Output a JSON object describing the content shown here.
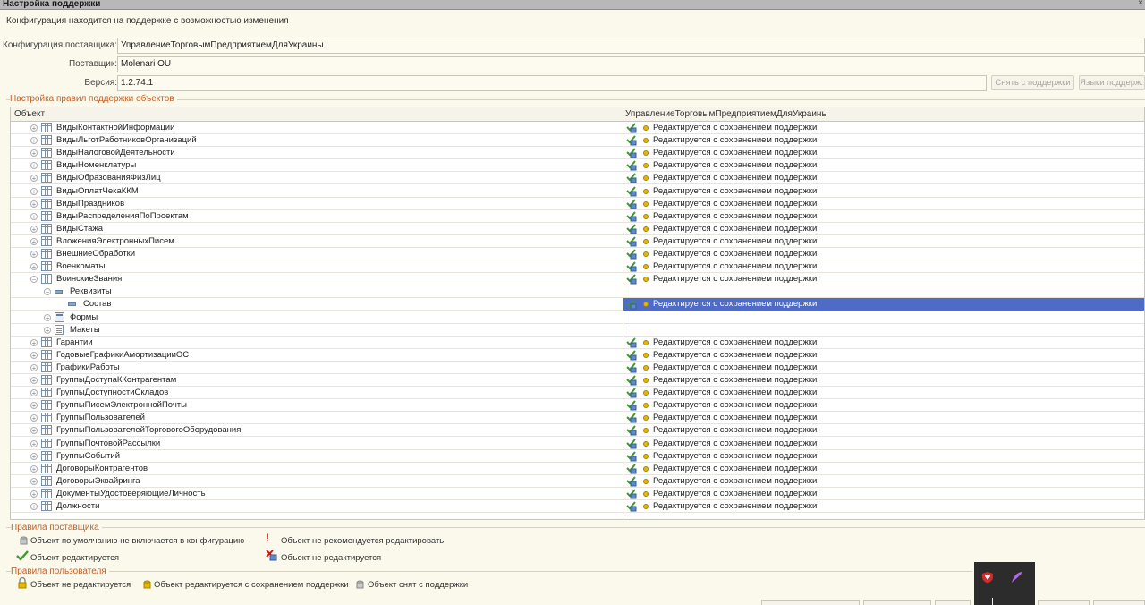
{
  "window": {
    "title": "Настройка поддержки",
    "close_glyph": "×"
  },
  "status_line": "Конфигурация находится на поддержке с возможностью изменения",
  "fields": {
    "config_label": "Конфигурация поставщика:",
    "config_value": "УправлениеТорговымПредприятиемДляУкраины",
    "vendor_label": "Поставщик:",
    "vendor_value": "Molenari OU",
    "version_label": "Версия:",
    "version_value": "1.2.74.1"
  },
  "buttons": {
    "remove_support": "Снять с поддержки",
    "languages": "Языки поддерж..."
  },
  "groups": {
    "object_rules": "Настройка правил поддержки объектов",
    "vendor_rules": "Правила поставщика",
    "user_rules": "Правила пользователя"
  },
  "table": {
    "col_object": "Объект",
    "col_config": "УправлениеТорговымПредприятиемДляУкраины",
    "rows": [
      {
        "name": "ВидыКонтактнойИнформации",
        "status": "Редактируется с сохранением поддержки"
      },
      {
        "name": "ВидыЛьготРаботниковОрганизаций",
        "status": "Редактируется с сохранением поддержки"
      },
      {
        "name": "ВидыНалоговойДеятельности",
        "status": "Редактируется с сохранением поддержки"
      },
      {
        "name": "ВидыНоменклатуры",
        "status": "Редактируется с сохранением поддержки"
      },
      {
        "name": "ВидыОбразованияФизЛиц",
        "status": "Редактируется с сохранением поддержки"
      },
      {
        "name": "ВидыОплатЧекаККМ",
        "status": "Редактируется с сохранением поддержки"
      },
      {
        "name": "ВидыПраздников",
        "status": "Редактируется с сохранением поддержки"
      },
      {
        "name": "ВидыРаспределенияПоПроектам",
        "status": "Редактируется с сохранением поддержки"
      },
      {
        "name": "ВидыСтажа",
        "status": "Редактируется с сохранением поддержки"
      },
      {
        "name": "ВложенияЭлектронныхПисем",
        "status": "Редактируется с сохранением поддержки"
      },
      {
        "name": "ВнешниеОбработки",
        "status": "Редактируется с сохранением поддержки"
      },
      {
        "name": "Военкоматы",
        "status": "Редактируется с сохранением поддержки"
      },
      {
        "name": "ВоинскиеЗвания",
        "status": "Редактируется с сохранением поддержки"
      },
      {
        "name": "Реквизиты",
        "status": ""
      },
      {
        "name": "Состав",
        "status": "Редактируется с сохранением поддержки"
      },
      {
        "name": "Формы",
        "status": ""
      },
      {
        "name": "Макеты",
        "status": ""
      },
      {
        "name": "Гарантии",
        "status": "Редактируется с сохранением поддержки"
      },
      {
        "name": "ГодовыеГрафикиАмортизацииОС",
        "status": "Редактируется с сохранением поддержки"
      },
      {
        "name": "ГрафикиРаботы",
        "status": "Редактируется с сохранением поддержки"
      },
      {
        "name": "ГруппыДоступаККонтрагентам",
        "status": "Редактируется с сохранением поддержки"
      },
      {
        "name": "ГруппыДоступностиСкладов",
        "status": "Редактируется с сохранением поддержки"
      },
      {
        "name": "ГруппыПисемЭлектроннойПочты",
        "status": "Редактируется с сохранением поддержки"
      },
      {
        "name": "ГруппыПользователей",
        "status": "Редактируется с сохранением поддержки"
      },
      {
        "name": "ГруппыПользователейТорговогоОборудования",
        "status": "Редактируется с сохранением поддержки"
      },
      {
        "name": "ГруппыПочтовойРассылки",
        "status": "Редактируется с сохранением поддержки"
      },
      {
        "name": "ГруппыСобытий",
        "status": "Редактируется с сохранением поддержки"
      },
      {
        "name": "ДоговорыКонтрагентов",
        "status": "Редактируется с сохранением поддержки"
      },
      {
        "name": "ДоговорыЭквайринга",
        "status": "Редактируется с сохранением поддержки"
      },
      {
        "name": "ДокументыУдостоверяющиеЛичность",
        "status": "Редактируется с сохранением поддержки"
      },
      {
        "name": "Должности",
        "status": "Редактируется с сохранением поддержки"
      }
    ]
  },
  "vendor_legend": {
    "not_included": "Объект по умолчанию не включается в конфигурацию",
    "not_recommended": "Объект не рекомендуется редактировать",
    "editable": "Объект редактируется",
    "not_editable": "Объект не редактируется"
  },
  "user_legend": {
    "not_editable": "Объект не редактируется",
    "edit_with_support": "Объект редактируется с сохранением поддержки",
    "removed": "Объект снят с поддержки"
  },
  "colors": {
    "accent_orange": "#c06028",
    "selection": "#4f6bc8",
    "check_green": "#3c9a2c",
    "lock_yellow": "#e6b800"
  }
}
